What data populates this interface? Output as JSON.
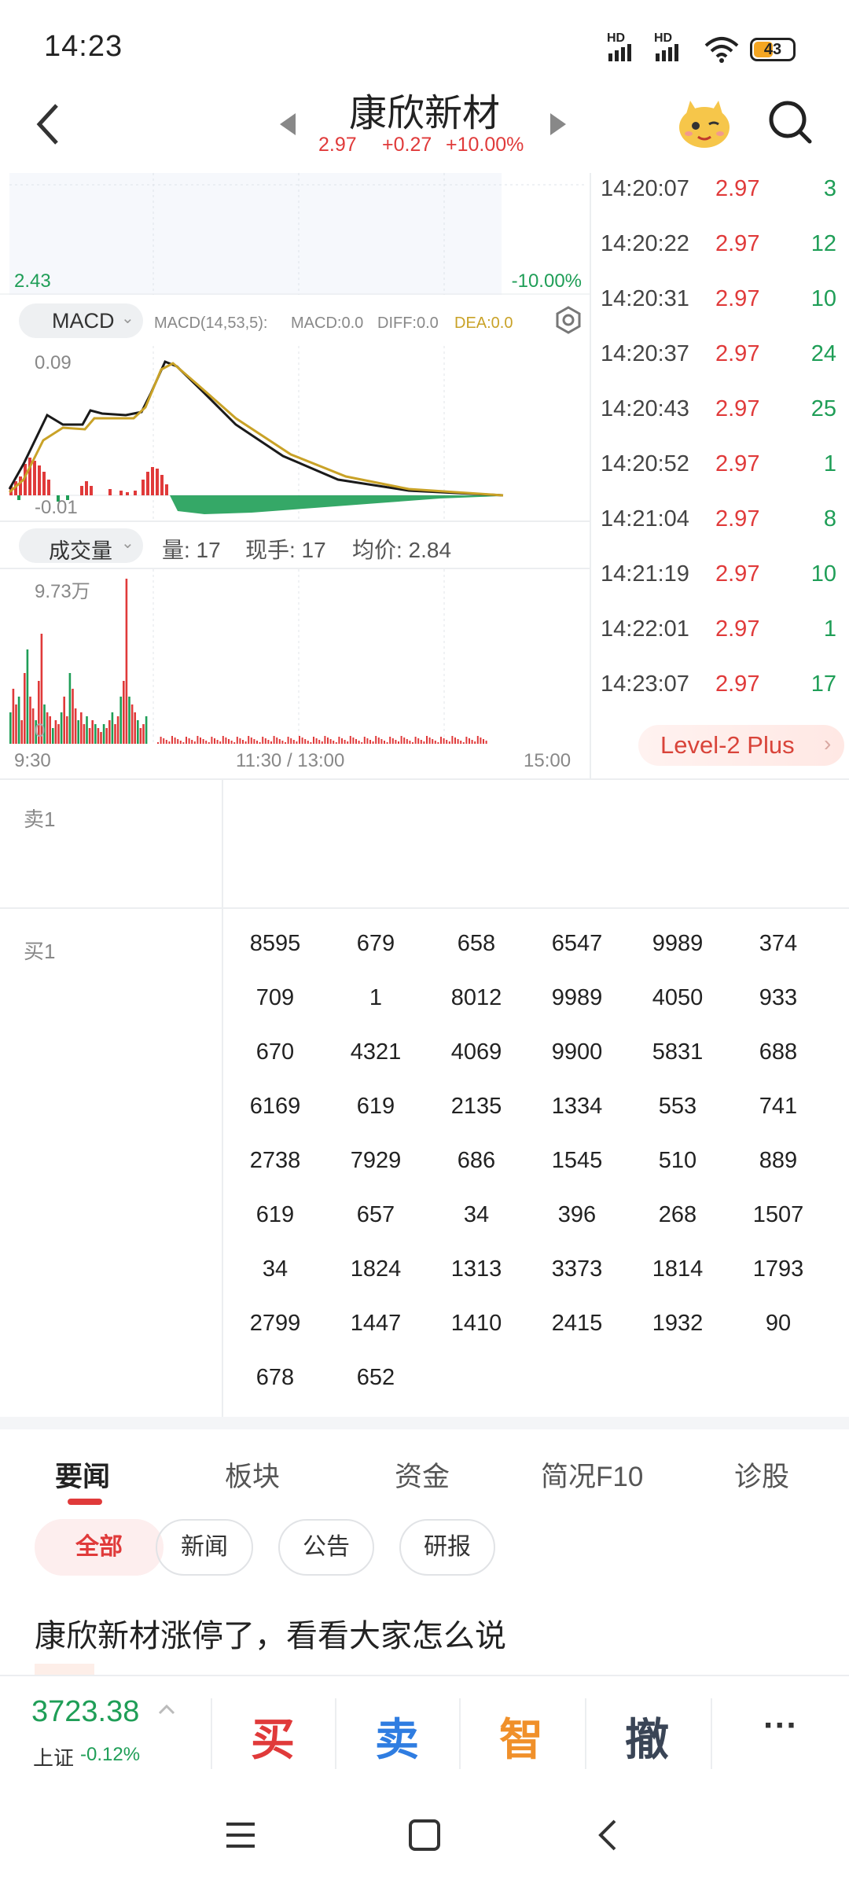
{
  "status": {
    "time": "14:23",
    "sim1": "HD",
    "sim2": "HD",
    "battery": "43"
  },
  "header": {
    "stock_name": "康欣新材",
    "price": "2.97",
    "change": "+0.27",
    "change_pct": "+10.00%"
  },
  "chart": {
    "price_low_label": "2.43",
    "pct_low_label": "-10.00%",
    "macd": {
      "selector": "MACD",
      "params": "MACD(14,53,5):",
      "macd_value": "MACD:0.0",
      "diff_value": "DIFF:0.0",
      "dea_value": "DEA:0.0",
      "y_top": "0.09",
      "y_bottom": "-0.01"
    },
    "volume": {
      "selector": "成交量",
      "qty": "量: 17",
      "current": "现手: 17",
      "avg_price": "均价: 2.84",
      "y_top": "9.73万",
      "y_zero": "0"
    },
    "time_axis": {
      "start": "9:30",
      "mid": "11:30 / 13:00",
      "end": "15:00"
    }
  },
  "ticks": [
    {
      "time": "14:20:07",
      "price": "2.97",
      "vol": "3"
    },
    {
      "time": "14:20:22",
      "price": "2.97",
      "vol": "12"
    },
    {
      "time": "14:20:31",
      "price": "2.97",
      "vol": "10"
    },
    {
      "time": "14:20:37",
      "price": "2.97",
      "vol": "24"
    },
    {
      "time": "14:20:43",
      "price": "2.97",
      "vol": "25"
    },
    {
      "time": "14:20:52",
      "price": "2.97",
      "vol": "1"
    },
    {
      "time": "14:21:04",
      "price": "2.97",
      "vol": "8"
    },
    {
      "time": "14:21:19",
      "price": "2.97",
      "vol": "10"
    },
    {
      "time": "14:22:01",
      "price": "2.97",
      "vol": "1"
    },
    {
      "time": "14:23:07",
      "price": "2.97",
      "vol": "17"
    }
  ],
  "level2_label": "Level-2 Plus",
  "orderbook": {
    "sell1_label": "卖1",
    "buy1_label": "买1",
    "buy1_queue": [
      "8595",
      "679",
      "658",
      "6547",
      "9989",
      "374",
      "709",
      "1",
      "8012",
      "9989",
      "4050",
      "933",
      "670",
      "4321",
      "4069",
      "9900",
      "5831",
      "688",
      "6169",
      "619",
      "2135",
      "1334",
      "553",
      "741",
      "2738",
      "7929",
      "686",
      "1545",
      "510",
      "889",
      "619",
      "657",
      "34",
      "396",
      "268",
      "1507",
      "34",
      "1824",
      "1313",
      "3373",
      "1814",
      "1793",
      "2799",
      "1447",
      "1410",
      "2415",
      "1932",
      "90",
      "678",
      "652"
    ]
  },
  "tabs": [
    "要闻",
    "板块",
    "资金",
    "简况F10",
    "诊股"
  ],
  "chips": [
    "全部",
    "新闻",
    "公告",
    "研报"
  ],
  "news_headline": "康欣新材涨停了，看看大家怎么说",
  "index": {
    "value": "3723.38",
    "name": "上证",
    "change_pct": "-0.12%"
  },
  "actions": {
    "buy": "买",
    "sell": "卖",
    "smart": "智",
    "cancel": "撤",
    "more": "···"
  },
  "colors": {
    "up": "#e03a3a",
    "down": "#1f9e57",
    "dea": "#c9a227",
    "smart": "#f0902a",
    "sell": "#2f7de1",
    "cancel": "#3a4556"
  }
}
